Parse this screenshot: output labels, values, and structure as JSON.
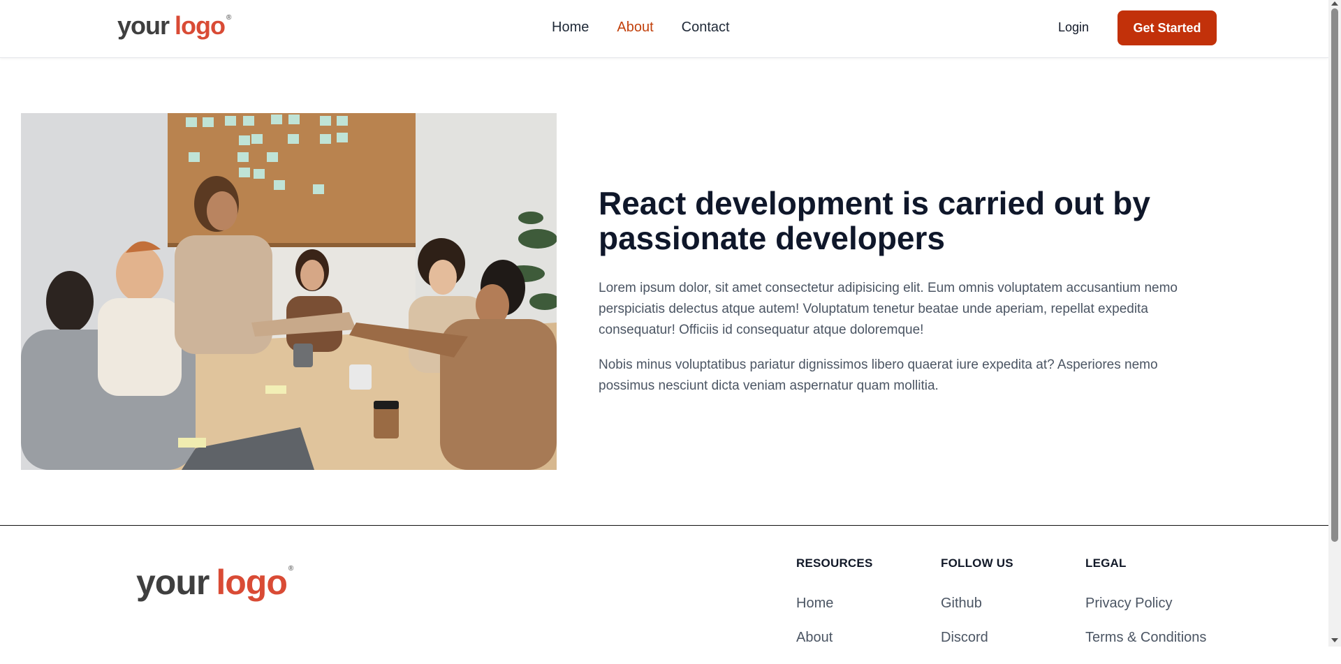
{
  "header": {
    "logo": {
      "word1": "your",
      "word2": "logo",
      "mark": "®"
    },
    "nav": [
      {
        "label": "Home",
        "active": false
      },
      {
        "label": "About",
        "active": true
      },
      {
        "label": "Contact",
        "active": false
      }
    ],
    "login_label": "Login",
    "cta_label": "Get Started"
  },
  "hero": {
    "image": "team-meeting-handshake-photo",
    "title": "React development is carried out by passionate developers",
    "paragraphs": [
      "Lorem ipsum dolor, sit amet consectetur adipisicing elit. Eum omnis voluptatem accusantium nemo perspiciatis delectus atque autem! Voluptatum tenetur beatae unde aperiam, repellat expedita consequatur! Officiis id consequatur atque doloremque!",
      "Nobis minus voluptatibus pariatur dignissimos libero quaerat iure expedita at? Asperiores nemo possimus nesciunt dicta veniam aspernatur quam mollitia."
    ]
  },
  "footer": {
    "logo": {
      "word1": "your",
      "word2": "logo",
      "mark": "®"
    },
    "columns": [
      {
        "title": "RESOURCES",
        "links": [
          "Home",
          "About"
        ]
      },
      {
        "title": "FOLLOW US",
        "links": [
          "Github",
          "Discord"
        ]
      },
      {
        "title": "LEGAL",
        "links": [
          "Privacy Policy",
          "Terms & Conditions"
        ]
      }
    ]
  },
  "colors": {
    "accent": "#c2310a",
    "active_nav": "#c2410c",
    "logo_red": "#d94b35",
    "logo_gray": "#3f3f3f"
  }
}
